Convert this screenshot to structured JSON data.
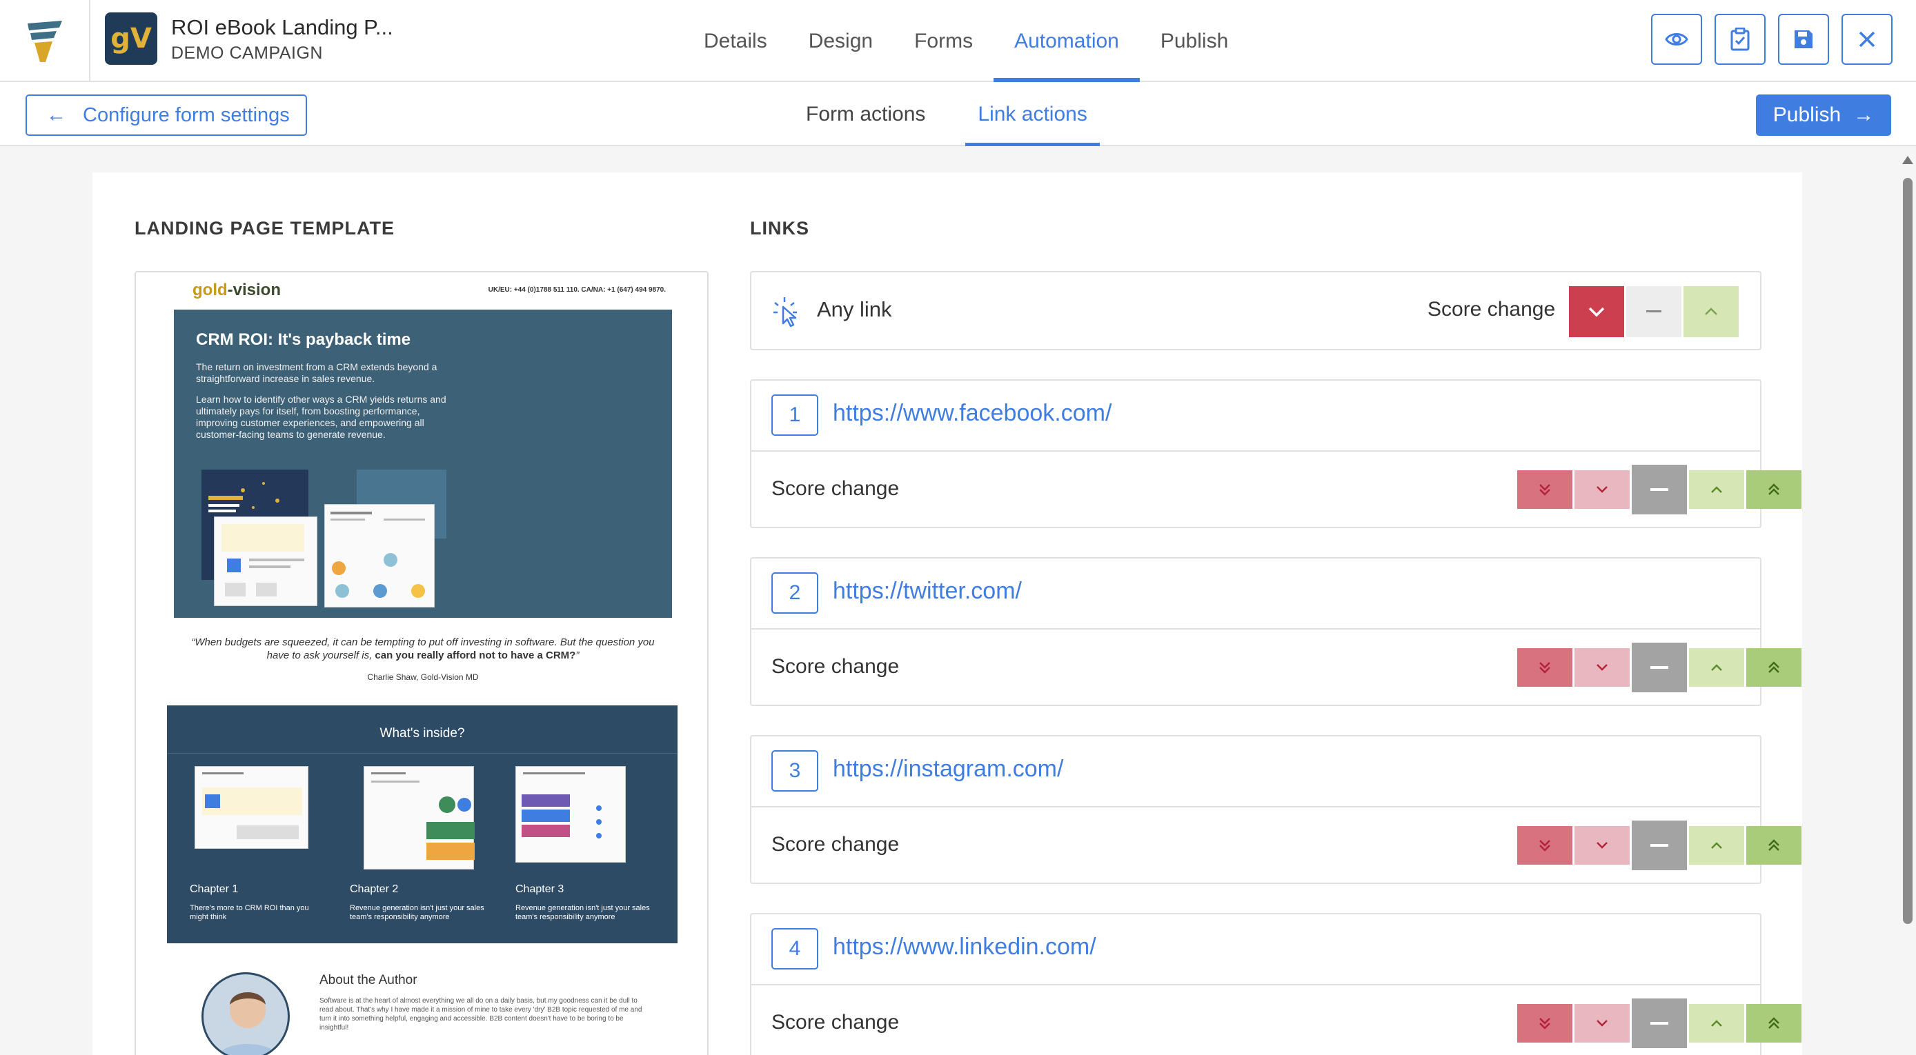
{
  "header": {
    "app_title": "ROI eBook Landing P...",
    "campaign": "DEMO CAMPAIGN",
    "avatar_text": "gV",
    "tabs": [
      {
        "label": "Details"
      },
      {
        "label": "Design"
      },
      {
        "label": "Forms"
      },
      {
        "label": "Automation",
        "active": true
      },
      {
        "label": "Publish"
      }
    ],
    "actions": [
      "eye-icon",
      "clipboard-check-icon",
      "save-icon",
      "close-icon"
    ]
  },
  "subbar": {
    "back_button": "Configure form settings",
    "tabs": [
      {
        "label": "Form actions"
      },
      {
        "label": "Link actions",
        "active": true
      }
    ],
    "publish_button": "Publish"
  },
  "template_section": {
    "title": "LANDING PAGE TEMPLATE",
    "preview": {
      "brand_a": "gold",
      "brand_b": "-vision",
      "contact": "UK/EU: +44 (0)1788 511 110. CA/NA: +1 (647) 494 9870.",
      "hero_title": "CRM ROI: It's payback time",
      "hero_p1": "The return on investment from a CRM extends beyond a straightforward increase in sales revenue.",
      "hero_p2": "Learn how to identify other ways a CRM yields returns and ultimately pays for itself, from boosting performance, improving customer experiences, and empowering all customer-facing teams to generate revenue.",
      "quote_a": "“When budgets are squeezed, it can be tempting to put off investing in software. But the question you have to ask yourself is, ",
      "quote_b": "can you really afford not to have a CRM?",
      "quote_c": "”",
      "cite": "Charlie Shaw, Gold-Vision MD",
      "inside_title": "What's inside?",
      "chapters": [
        {
          "title": "Chapter 1",
          "desc": "There's more to CRM ROI than you might think"
        },
        {
          "title": "Chapter 2",
          "desc": "Revenue generation isn't just your sales team's responsibility anymore"
        },
        {
          "title": "Chapter 3",
          "desc": "Revenue generation isn't just your sales team's responsibility anymore"
        }
      ],
      "about_title": "About the Author",
      "about_text": "Software is at the heart of almost everything we all do on a daily basis, but my goodness can it be dull to read about. That's why I have made it a mission of mine to take every 'dry' B2B topic requested of me and turn it into something helpful, engaging and accessible. B2B content doesn't have to be boring to be insightful!"
    }
  },
  "links_section": {
    "title": "LINKS",
    "any_link": {
      "label": "Any link",
      "score_label": "Score change",
      "selected": "down"
    },
    "links": [
      {
        "number": "1",
        "url": "https://www.facebook.com/",
        "score_label": "Score change",
        "selected": "neutral"
      },
      {
        "number": "2",
        "url": "https://twitter.com/",
        "score_label": "Score change",
        "selected": "neutral"
      },
      {
        "number": "3",
        "url": "https://instagram.com/",
        "score_label": "Score change",
        "selected": "neutral"
      },
      {
        "number": "4",
        "url": "https://www.linkedin.com/",
        "score_label": "Score change",
        "selected": "neutral"
      }
    ]
  },
  "colors": {
    "accent": "#3f7de0",
    "down_strong": "#d9727f",
    "down_light": "#e9b7bf",
    "neutral": "#a3a3a3",
    "up_light": "#d6e7b5",
    "up_strong": "#a9cc7a",
    "down_selected": "#cc3f4f"
  }
}
